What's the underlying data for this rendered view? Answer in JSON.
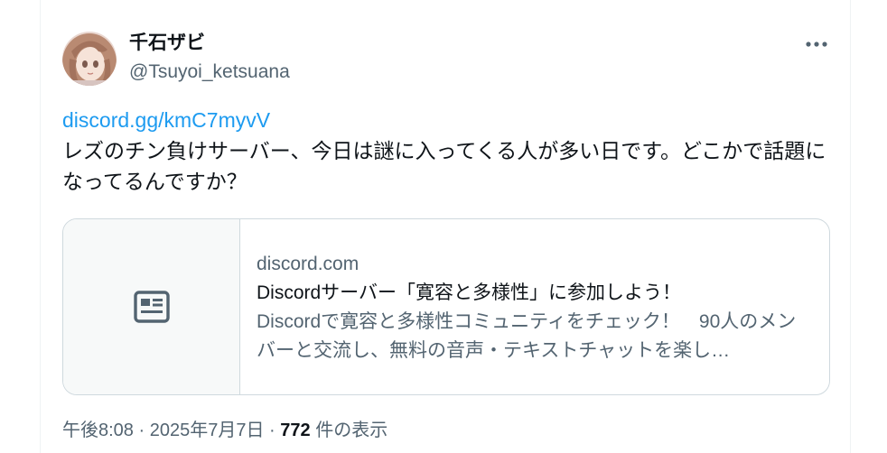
{
  "author": {
    "display_name": "千石ザビ",
    "handle": "@Tsuyoi_ketsuana",
    "avatar_icon": "anime-character-avatar"
  },
  "post": {
    "link_text": "discord.gg/kmC7myvV",
    "body": "レズのチン負けサーバー、今日は謎に入ってくる人が多い日です。どこかで話題になってるんですか？"
  },
  "link_card": {
    "thumbnail_icon": "article-icon",
    "domain": "discord.com",
    "title": "Discordサーバー「寛容と多様性」に参加しよう！",
    "description": "Discordで寛容と多様性コミュニティをチェック！　90人のメンバーと交流し、無料の音声・テキストチャットを楽し…"
  },
  "meta": {
    "time": "午後8:08",
    "separator": "·",
    "date": "2025年7月7日",
    "views_count": "772",
    "views_label": "件の表示"
  },
  "colors": {
    "link": "#1d9bf0",
    "text_primary": "#0f1419",
    "text_secondary": "#536471",
    "border": "#cfd9de"
  }
}
